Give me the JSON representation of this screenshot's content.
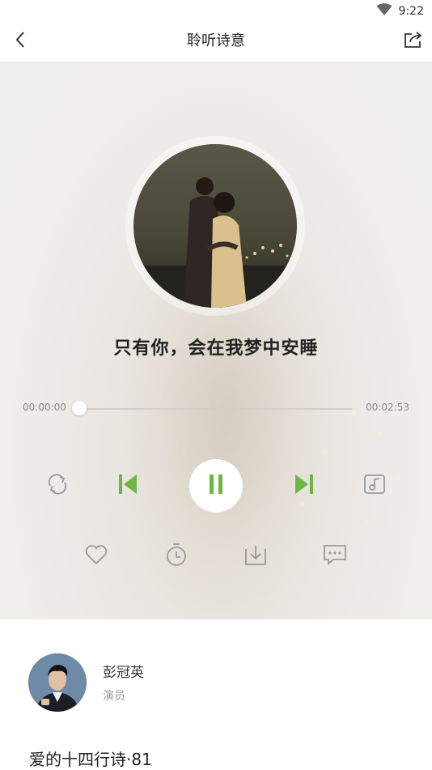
{
  "status_bar": {
    "time": "9:22",
    "wifi_icon": "wifi-icon"
  },
  "header": {
    "title": "聆听诗意",
    "back_icon": "chevron-left-icon",
    "share_icon": "share-icon"
  },
  "player": {
    "song_title": "只有你，会在我梦中安睡",
    "current_time": "00:00:00",
    "total_time": "00:02:53",
    "progress": 0,
    "accent_color": "#6fb640",
    "controls": [
      "repeat-icon",
      "previous-icon",
      "pause-icon",
      "next-icon",
      "lyrics-icon"
    ],
    "actions": [
      "heart-icon",
      "timer-icon",
      "download-icon",
      "comment-icon"
    ]
  },
  "reader": {
    "name": "彭冠英",
    "role": "演员"
  },
  "poem": {
    "title": "爱的十四行诗·81"
  }
}
